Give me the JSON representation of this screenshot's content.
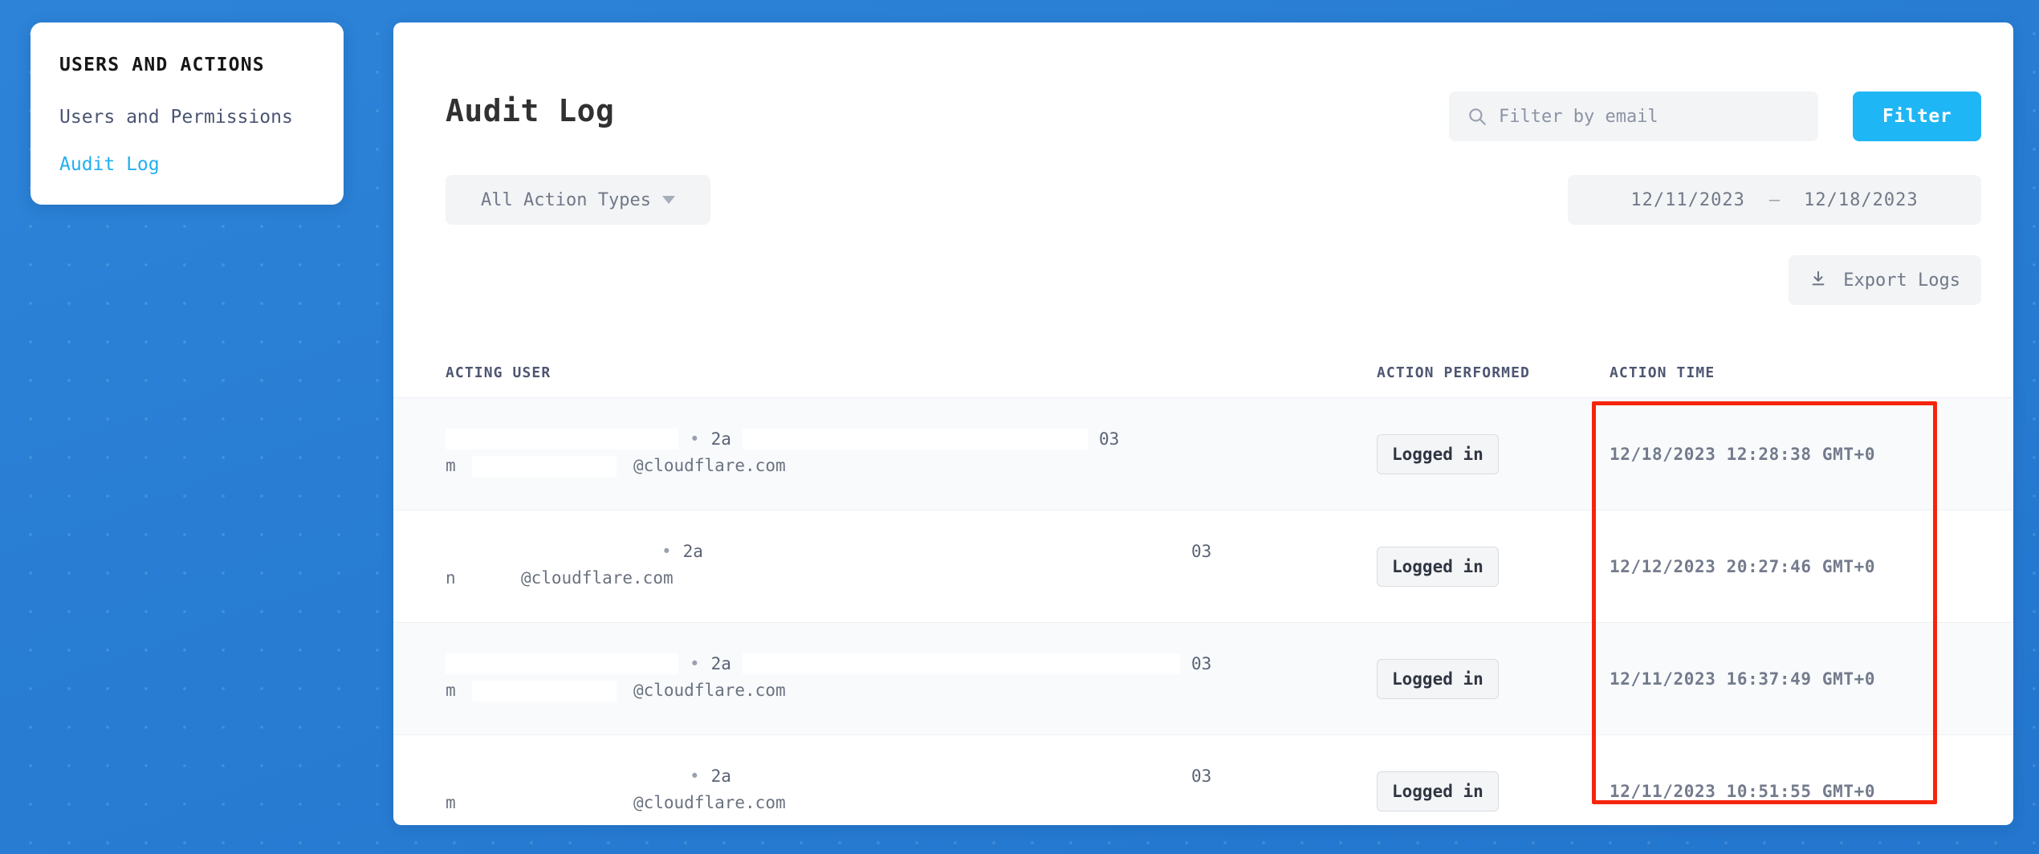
{
  "sidebar": {
    "title": "USERS AND ACTIONS",
    "items": [
      {
        "label": "Users and Permissions",
        "active": false
      },
      {
        "label": "Audit Log",
        "active": true
      }
    ]
  },
  "header": {
    "page_title": "Audit Log"
  },
  "search": {
    "placeholder": "Filter by email",
    "value": "",
    "icon": "search-icon",
    "filter_button_label": "Filter",
    "filter_button_color": "#1fb6f5"
  },
  "filters": {
    "action_type_label": "All Action Types",
    "action_type_caret": "chevron-down-icon",
    "date_start": "12/11/2023",
    "date_separator": "–",
    "date_end": "12/18/2023"
  },
  "export": {
    "label": "Export Logs",
    "icon": "download-icon"
  },
  "table": {
    "columns": [
      "ACTING USER",
      "ACTION PERFORMED",
      "ACTION TIME"
    ],
    "rows": [
      {
        "user_prefix": "",
        "user_mid": "2a",
        "user_suffix": "03",
        "email_prefix": "m",
        "email_suffix": "@cloudflare.com",
        "action": "Logged in",
        "time": "12/18/2023 12:28:38 GMT+0"
      },
      {
        "user_prefix": "",
        "user_mid": "2a",
        "user_suffix": "03",
        "email_prefix": "n",
        "email_suffix": "@cloudflare.com",
        "action": "Logged in",
        "time": "12/12/2023 20:27:46 GMT+0"
      },
      {
        "user_prefix": "",
        "user_mid": "2a",
        "user_suffix": "03",
        "email_prefix": "m",
        "email_suffix": "@cloudflare.com",
        "action": "Logged in",
        "time": "12/11/2023 16:37:49 GMT+0"
      },
      {
        "user_prefix": "",
        "user_mid": "2a",
        "user_suffix": "03",
        "email_prefix": "m",
        "email_suffix": "@cloudflare.com",
        "action": "Logged in",
        "time": "12/11/2023 10:51:55 GMT+0"
      }
    ]
  },
  "annotation": {
    "color": "#f5250d"
  }
}
